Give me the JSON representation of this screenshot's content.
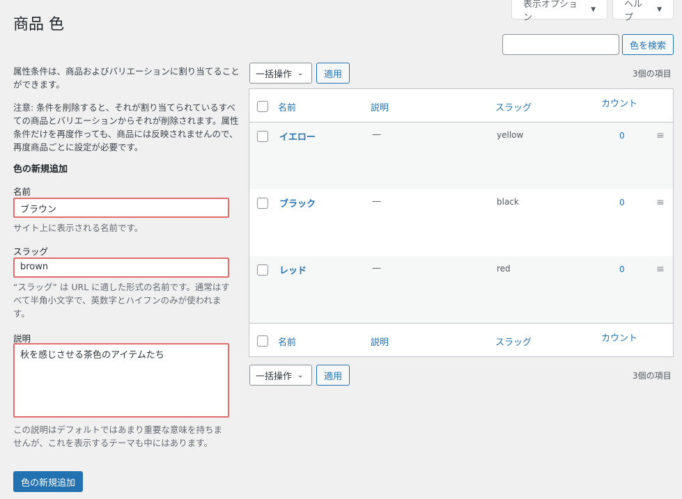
{
  "header": {
    "title": "商品 色",
    "screen_options": "表示オプション",
    "help": "ヘルプ",
    "search_placeholder": "",
    "search_button": "色を検索"
  },
  "form": {
    "intro": "属性条件は、商品およびバリエーションに割り当てることができます。",
    "note": "注意: 条件を削除すると、それが割り当てられているすべての商品とバリエーションからそれが削除されます。属性条件だけを再度作っても、商品には反映されませんので、再度商品ごとに設定が必要です。",
    "heading": "色の新規追加",
    "name_label": "名前",
    "name_value": "ブラウン",
    "name_help": "サイト上に表示される名前です。",
    "slug_label": "スラッグ",
    "slug_value": "brown",
    "slug_help": "“スラッグ” は URL に適した形式の名前です。通常はすべて半角小文字で、英数字とハイフンのみが使われます。",
    "desc_label": "説明",
    "desc_value": "秋を感じさせる茶色のアイテムたち",
    "desc_help": "この説明はデフォルトではあまり重要な意味を持ちませんが、これを表示するテーマも中にはあります。",
    "submit": "色の新規追加"
  },
  "list": {
    "bulk_action": "一括操作",
    "apply": "適用",
    "item_count": "3個の項目",
    "columns": {
      "name": "名前",
      "description": "説明",
      "slug": "スラッグ",
      "count": "カウント"
    },
    "rows": [
      {
        "name": "イエロー",
        "description": "—",
        "slug": "yellow",
        "count": "0"
      },
      {
        "name": "ブラック",
        "description": "—",
        "slug": "black",
        "count": "0"
      },
      {
        "name": "レッド",
        "description": "—",
        "slug": "red",
        "count": "0"
      }
    ]
  },
  "icons": {
    "dropdown": "triangle-down-icon",
    "select_chevron": "chevron-down-icon",
    "drag": "drag-handle-icon"
  }
}
